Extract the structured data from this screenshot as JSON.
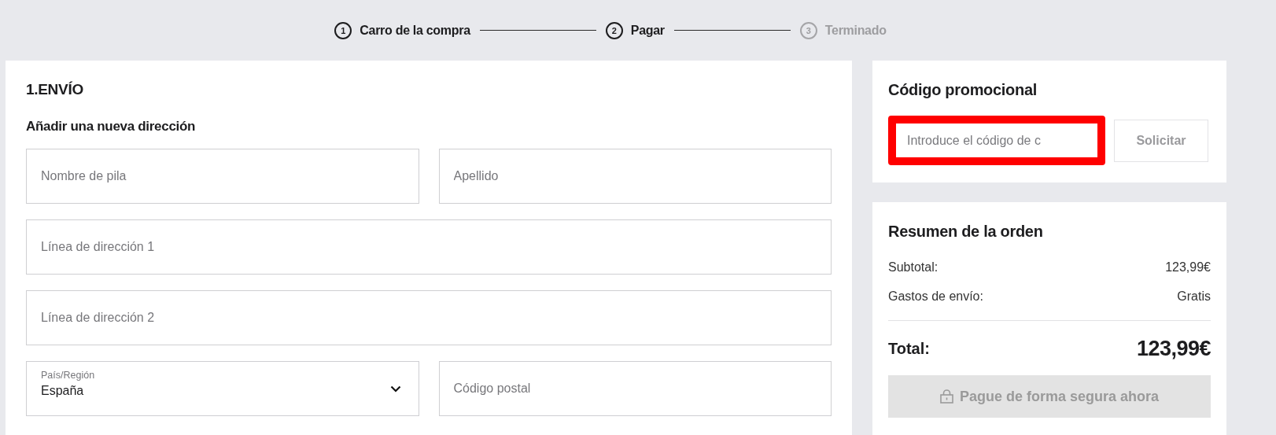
{
  "steps": [
    {
      "number": "1",
      "label": "Carro de la compra",
      "disabled": false
    },
    {
      "number": "2",
      "label": "Pagar",
      "disabled": false
    },
    {
      "number": "3",
      "label": "Terminado",
      "disabled": true
    }
  ],
  "shipping": {
    "title": "1.ENVÍO",
    "subtitle": "Añadir una nueva dirección",
    "rows": [
      [
        {
          "kind": "text",
          "placeholder": "Nombre de pila"
        },
        {
          "kind": "text",
          "placeholder": "Apellido"
        }
      ],
      [
        {
          "kind": "text",
          "placeholder": "Línea de dirección 1"
        }
      ],
      [
        {
          "kind": "text",
          "placeholder": "Línea de dirección 2"
        }
      ],
      [
        {
          "kind": "select",
          "label": "País/Región",
          "value": "España"
        },
        {
          "kind": "text",
          "placeholder": "Código postal"
        }
      ]
    ]
  },
  "promo": {
    "title": "Código promocional",
    "placeholder": "Introduce el código de c",
    "button": "Solicitar"
  },
  "summary": {
    "title": "Resumen de la orden",
    "lines": [
      {
        "label": "Subtotal:",
        "value": "123,99€"
      },
      {
        "label": "Gastos de envío:",
        "value": "Gratis"
      }
    ],
    "total_label": "Total:",
    "total_value": "123,99€",
    "pay_button": "Pague de forma segura ahora"
  }
}
